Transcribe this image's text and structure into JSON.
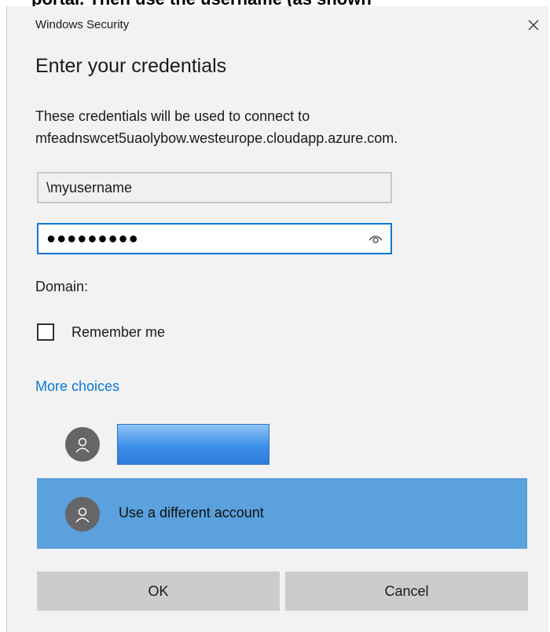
{
  "window": {
    "title": "Windows Security"
  },
  "heading": "Enter your credentials",
  "description": {
    "line1": "These credentials will be used to connect to",
    "line2": "mfeadnswcet5uaolybow.westeurope.cloudapp.azure.com."
  },
  "form": {
    "username_value": "\\myusername",
    "password_masked": "●●●●●●●●●",
    "domain_label": "Domain:",
    "remember_label": "Remember me",
    "remember_checked": false
  },
  "more_choices": {
    "label": "More choices",
    "accounts": [
      {
        "label": "",
        "icon": "user-avatar-icon",
        "redacted": true
      },
      {
        "label": "Use a different account",
        "icon": "user-avatar-icon",
        "selected": true
      }
    ]
  },
  "buttons": {
    "ok": "OK",
    "cancel": "Cancel"
  },
  "colors": {
    "accent": "#0a78d7",
    "selected_row": "#5aa1dd",
    "dialog_bg": "#f2f2f2",
    "button_bg": "#cccccc"
  }
}
